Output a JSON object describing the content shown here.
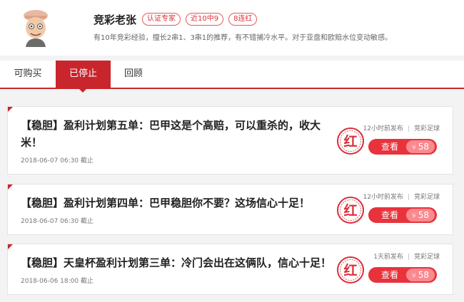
{
  "expert": {
    "name": "竞彩老张",
    "badges": [
      "认证专家",
      "近10中9",
      "8连红"
    ],
    "description": "有10年竞彩经验，擅长2串1、3串1的推荐，有不错捕冷水平。对于亚盘和欧赔水位变动敏感。"
  },
  "tabs": [
    {
      "label": "可购买",
      "active": false
    },
    {
      "label": "已停止",
      "active": true
    },
    {
      "label": "回顾",
      "active": false
    }
  ],
  "stamp_char": "红",
  "view_label": "查看",
  "currency": "¥",
  "colors": {
    "accent": "#c9252c",
    "button": "#e8333c"
  },
  "cards": [
    {
      "title": "【稳胆】盈利计划第五单：巴甲这是个高赔，可以重杀的，收大米！",
      "date": "2018-06-07  06:30 截止",
      "posted": "12小时前发布",
      "category": "竞彩足球",
      "price": "58"
    },
    {
      "title": "【稳胆】盈利计划第四单：巴甲稳胆你不要？这场信心十足！",
      "date": "2018-06-07  06:30 截止",
      "posted": "12小时前发布",
      "category": "竞彩足球",
      "price": "58"
    },
    {
      "title": "【稳胆】天皇杯盈利计划第三单：冷门会出在这俩队，信心十足！",
      "date": "2018-06-06  18:00 截止",
      "posted": "1天前发布",
      "category": "竞彩足球",
      "price": "58"
    }
  ]
}
